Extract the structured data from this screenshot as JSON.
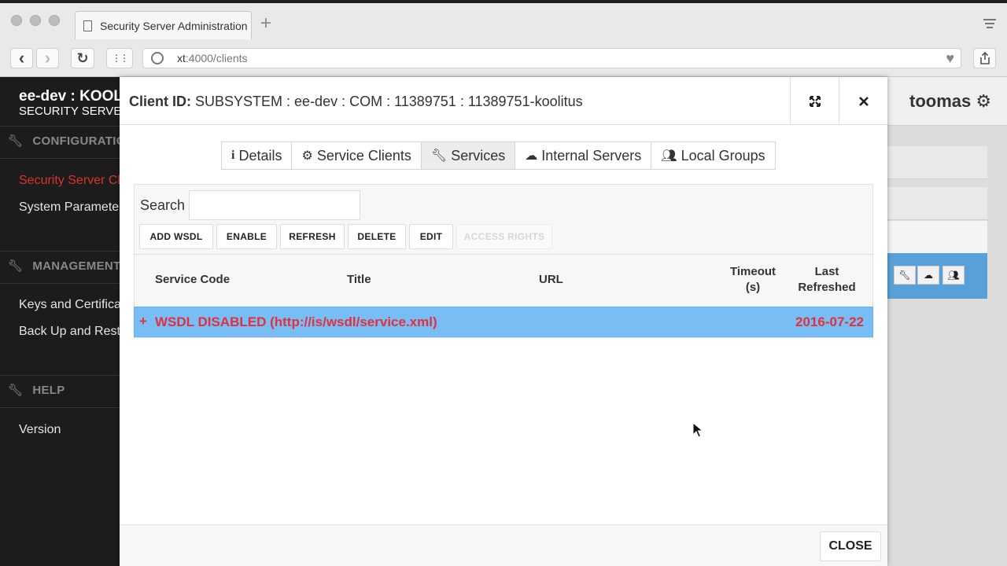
{
  "browser": {
    "tab_title": "Security Server Administration",
    "url_host": "xt",
    "url_path": ":4000/clients",
    "new_tab": "+",
    "back": "‹",
    "forward": "›",
    "reload": "↻",
    "grid": "⋮⋮"
  },
  "sidebar": {
    "title": "ee-dev : KOOLITUS",
    "subtitle": "SECURITY SERVER",
    "sections": [
      {
        "label": "CONFIGURATION",
        "items": [
          "Security Server Clients",
          "System Parameters"
        ]
      },
      {
        "label": "MANAGEMENT",
        "items": [
          "Keys and Certificates",
          "Back Up and Restore"
        ]
      },
      {
        "label": "HELP",
        "items": [
          "Version"
        ]
      }
    ]
  },
  "user": {
    "name": "toomas"
  },
  "modal": {
    "title_prefix": "Client ID:",
    "title_value": "SUBSYSTEM : ee-dev : COM : 11389751 : 11389751-koolitus",
    "tabs": [
      "Details",
      "Service Clients",
      "Services",
      "Internal Servers",
      "Local Groups"
    ],
    "active_tab": "Services",
    "search_label": "Search",
    "search_value": "",
    "actions": [
      "ADD WSDL",
      "ENABLE",
      "REFRESH",
      "DELETE",
      "EDIT",
      "ACCESS RIGHTS"
    ],
    "columns": {
      "service_code": "Service Code",
      "title": "Title",
      "url": "URL",
      "timeout_1": "Timeout",
      "timeout_2": "(s)",
      "refreshed_1": "Last",
      "refreshed_2": "Refreshed"
    },
    "rows": [
      {
        "expander": "+",
        "label": "WSDL DISABLED (http://is/wsdl/service.xml)",
        "last_refreshed": "2016-07-22"
      }
    ],
    "close_label": "CLOSE"
  },
  "colors": {
    "accent_red": "#e2303d",
    "selected_row": "#79bdf5",
    "sidebar_active": "#d9342b"
  }
}
